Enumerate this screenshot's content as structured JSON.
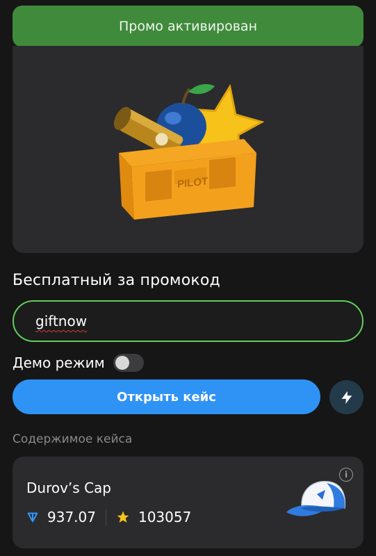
{
  "banner": {
    "text": "Промо активирован"
  },
  "case": {
    "image": "case-crate-image"
  },
  "section": {
    "title": "Бесплатный за промокод"
  },
  "promo": {
    "value": "giftnow"
  },
  "demo": {
    "label": "Демо режим",
    "enabled": false
  },
  "actions": {
    "open_label": "Открыть кейс",
    "quick_icon": "lightning-icon"
  },
  "contents": {
    "label": "Содержимое кейса",
    "items": [
      {
        "name": "Durov’s Cap",
        "ton_price": "937.07",
        "stars_price": "103057",
        "icon": "cap-icon"
      }
    ]
  },
  "colors": {
    "banner": "#3f8a3b",
    "accent": "#2f93f5",
    "input_border": "#5fcf5a",
    "ton": "#2f93f5",
    "star": "#f5c518"
  }
}
